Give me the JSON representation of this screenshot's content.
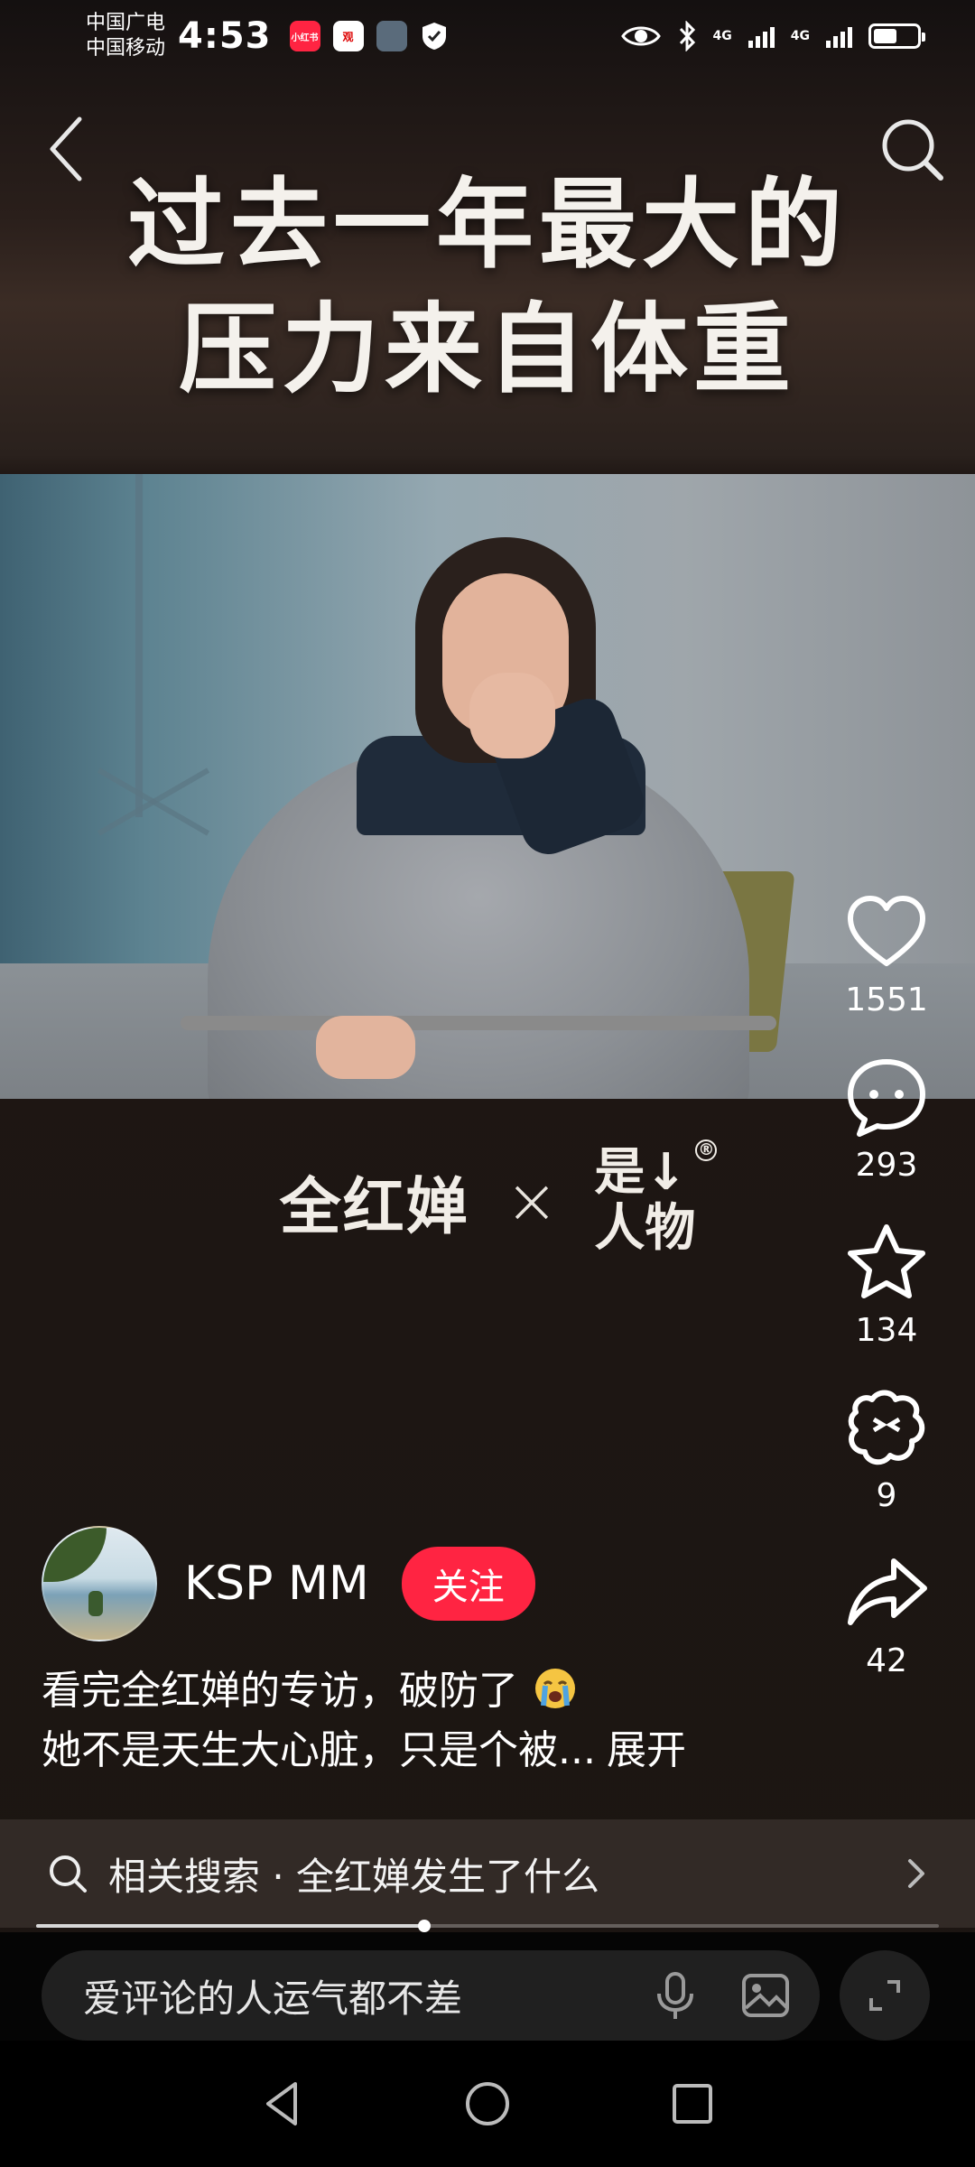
{
  "status_bar": {
    "carrier_1": "中国广电",
    "carrier_2": "中国移动",
    "time": "4:53",
    "badge_1": "小红书",
    "net_1": "4G",
    "net_2": "4G",
    "battery_level": 0.6
  },
  "video": {
    "title_line_1": "过去一年最大的",
    "title_line_2": "压力来自体重",
    "brand_name": "全红婵",
    "brand_x": "×",
    "brand_logo_line_1": "是↓",
    "brand_logo_line_2": "人物",
    "brand_logo_mark": "®",
    "progress": 0.43
  },
  "actions": {
    "like_count": "1551",
    "comment_count": "293",
    "collect_count": "134",
    "funny_count": "9",
    "share_count": "42"
  },
  "author": {
    "name": "KSP MM",
    "follow_label": "关注"
  },
  "description": {
    "line_1": "看完全红婵的专访，破防了",
    "line_2": "她不是天生大心脏，只是个被...",
    "expand_label": "展开"
  },
  "related_search": {
    "label": "相关搜索 · 全红婵发生了什么"
  },
  "comment_bar": {
    "placeholder": "爱评论的人运气都不差"
  },
  "colors": {
    "accent": "#ff2442"
  }
}
